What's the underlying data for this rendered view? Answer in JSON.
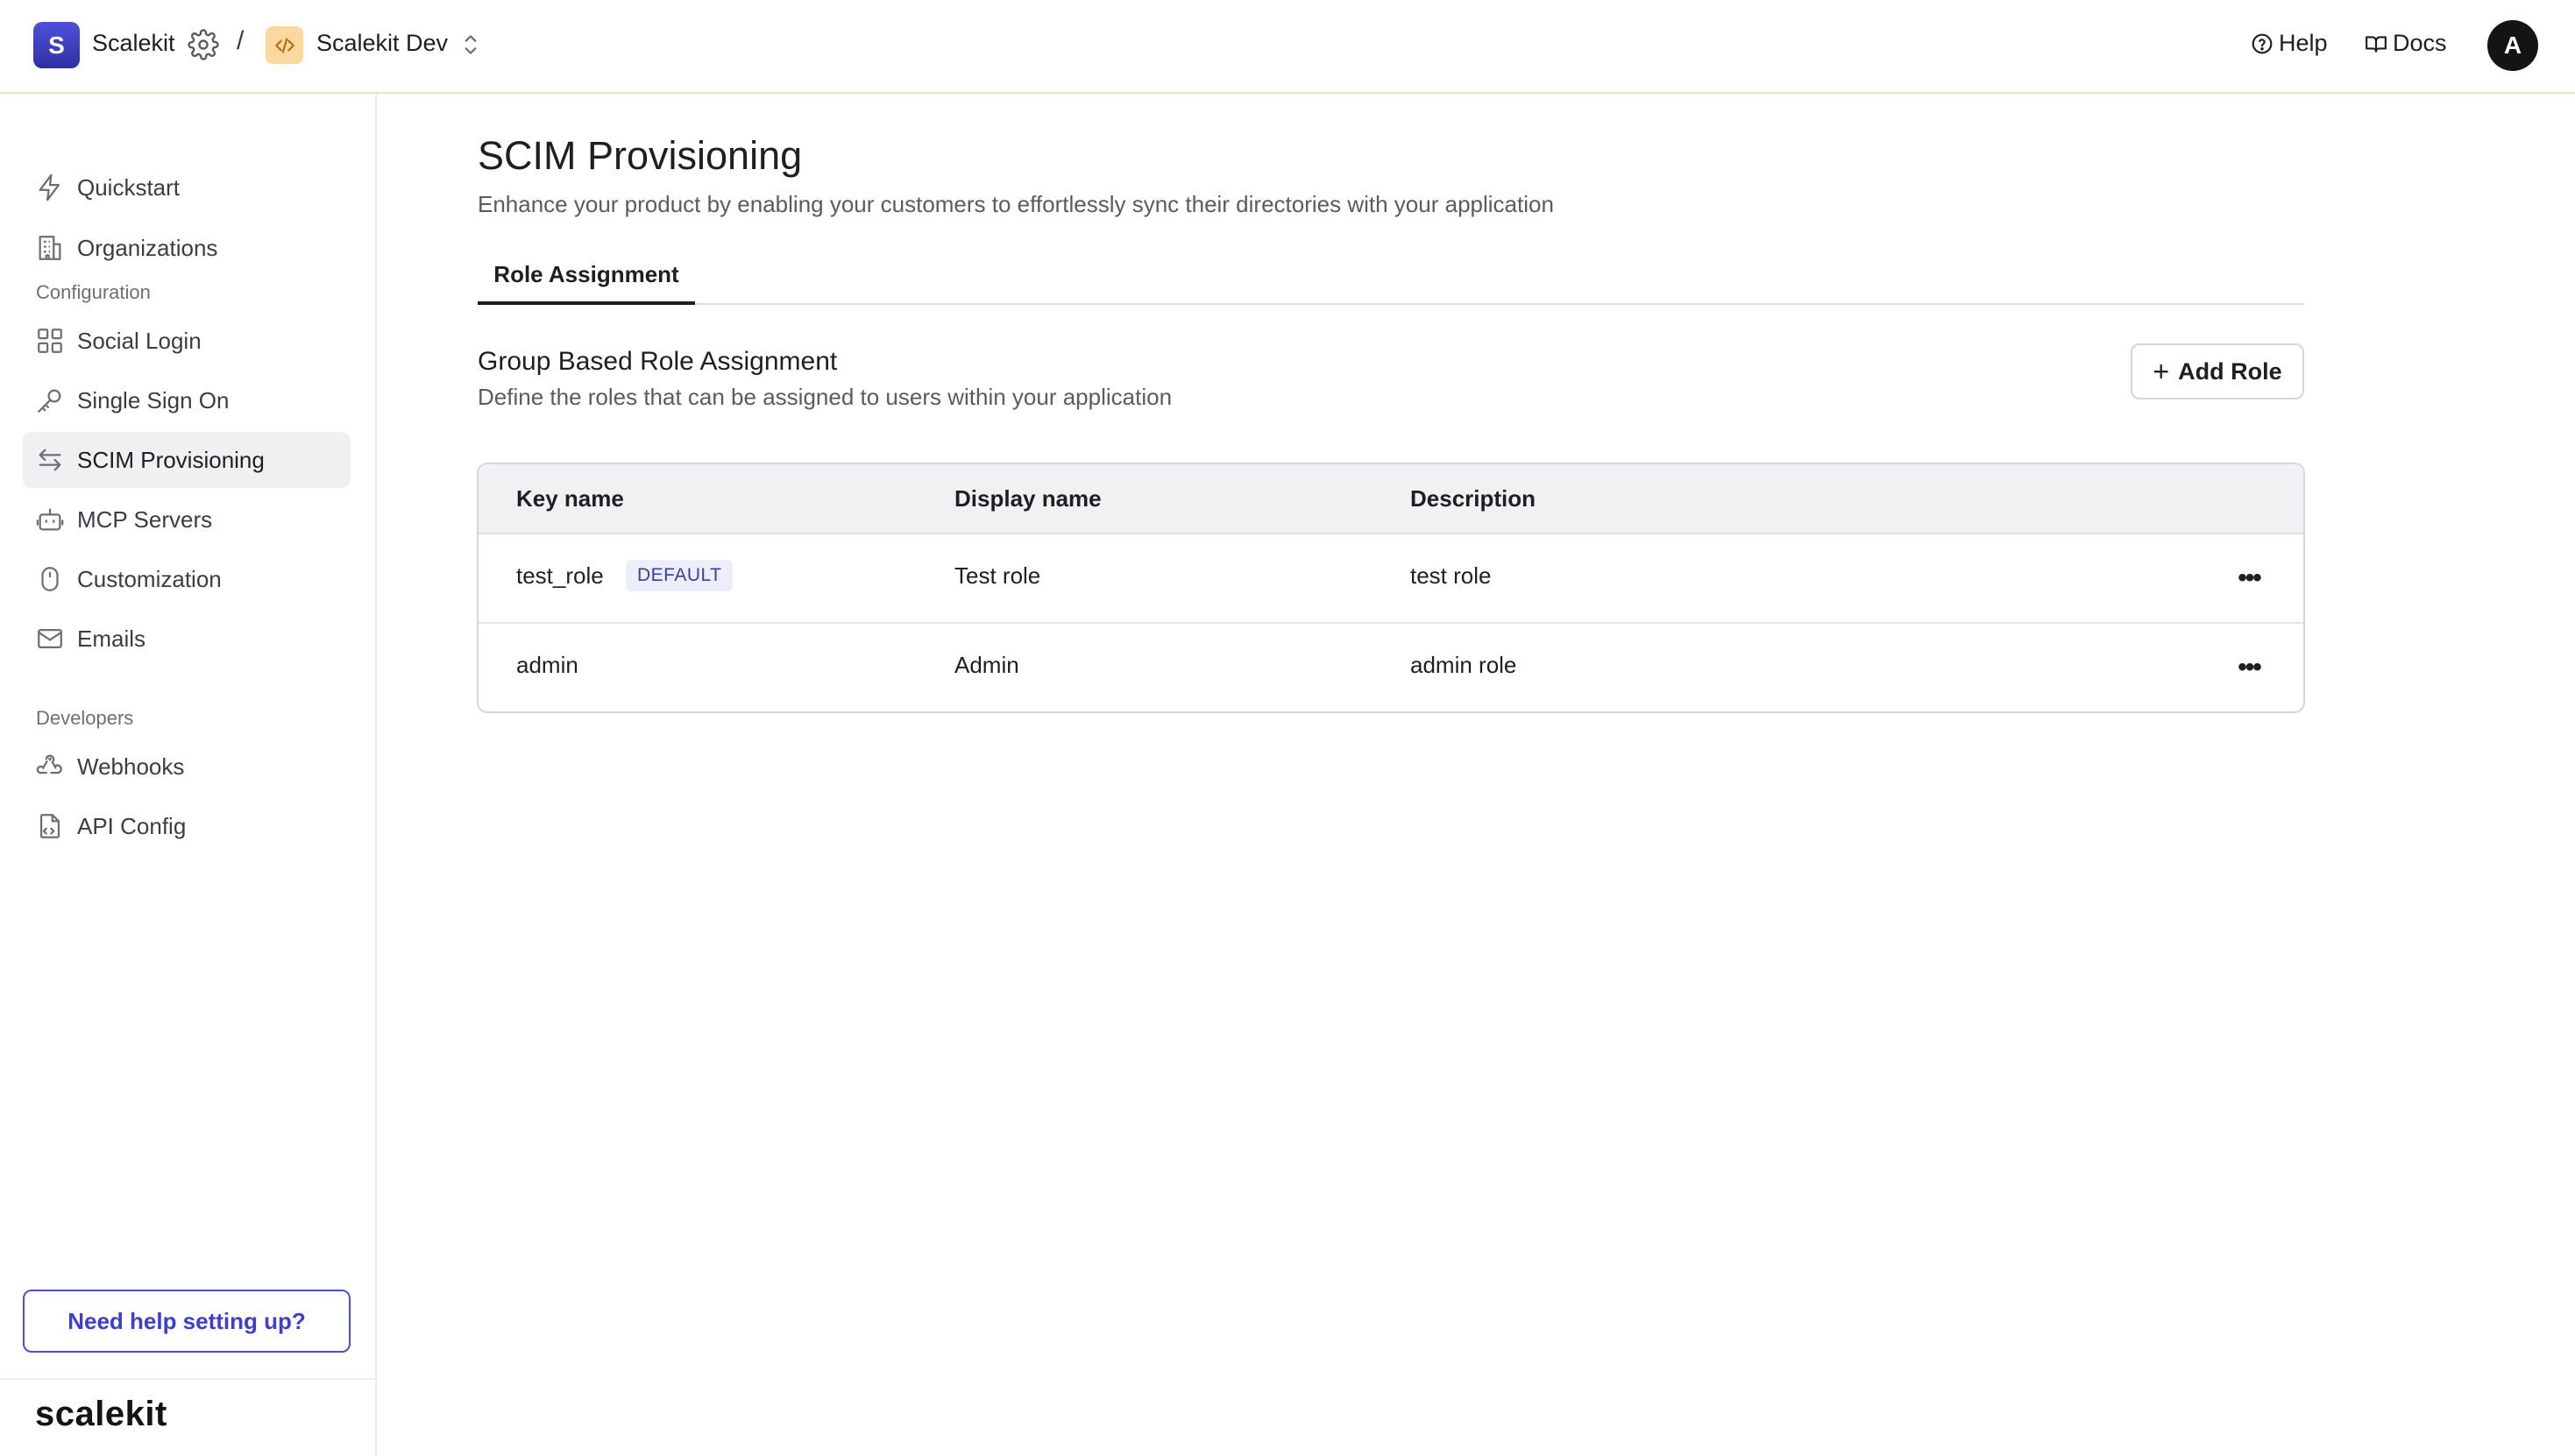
{
  "topbar": {
    "workspace_initial": "S",
    "workspace_name": "Scalekit",
    "separator": "/",
    "environment_name": "Scalekit Dev",
    "help_label": "Help",
    "docs_label": "Docs",
    "avatar_initial": "A"
  },
  "sidebar": {
    "items_top": [
      {
        "label": "Quickstart",
        "icon": "lightning-icon"
      },
      {
        "label": "Organizations",
        "icon": "building-icon"
      }
    ],
    "section_configuration": "Configuration",
    "items_config": [
      {
        "label": "Social Login",
        "icon": "grid-icon"
      },
      {
        "label": "Single Sign On",
        "icon": "key-icon"
      },
      {
        "label": "SCIM Provisioning",
        "icon": "arrows-swap-icon",
        "active": true
      },
      {
        "label": "MCP Servers",
        "icon": "robot-icon"
      },
      {
        "label": "Customization",
        "icon": "mouse-icon"
      },
      {
        "label": "Emails",
        "icon": "mail-icon"
      }
    ],
    "section_developers": "Developers",
    "items_dev": [
      {
        "label": "Webhooks",
        "icon": "webhook-icon"
      },
      {
        "label": "API Config",
        "icon": "file-code-icon"
      }
    ],
    "help_button": "Need help setting up?",
    "brand": "scalekit"
  },
  "main": {
    "title": "SCIM Provisioning",
    "subtitle": "Enhance your product by enabling your customers to effortlessly sync their directories with your application",
    "tabs": [
      {
        "label": "Role Assignment",
        "active": true
      }
    ],
    "section_title": "Group Based Role Assignment",
    "section_subtitle": "Define the roles that can be assigned to users within your application",
    "add_role_label": "Add Role",
    "table": {
      "headers": [
        "Key name",
        "Display name",
        "Description"
      ],
      "rows": [
        {
          "key": "test_role",
          "badge": "DEFAULT",
          "display": "Test role",
          "description": "test role"
        },
        {
          "key": "admin",
          "badge": "",
          "display": "Admin",
          "description": "admin role"
        }
      ]
    }
  },
  "colors": {
    "accent": "#4a4fd6",
    "env_badge": "#fbd89d",
    "active_nav": "#f0f0f2"
  }
}
